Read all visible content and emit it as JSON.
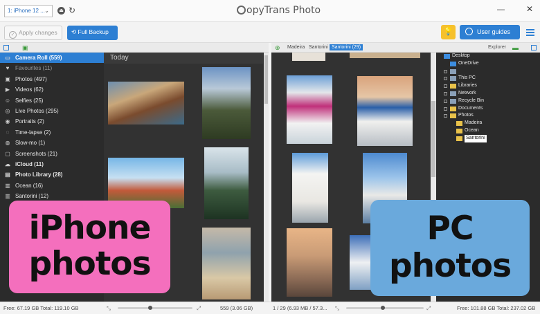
{
  "titlebar": {
    "device_name": "1: iPhone 12 ...",
    "app_title": "opyTrans Photo"
  },
  "toolbar": {
    "apply_label": "Apply changes",
    "backup_label": "Full Backup",
    "guides_label": "User guides"
  },
  "left_panel": {
    "items": [
      {
        "label": "Camera Roll (559)",
        "icon": "camera-icon",
        "state": "selected"
      },
      {
        "label": "Favourites (11)",
        "icon": "heart-icon",
        "state": "dim"
      },
      {
        "label": "Photos (497)",
        "icon": "image-icon",
        "state": "normal"
      },
      {
        "label": "Videos (62)",
        "icon": "video-icon",
        "state": "normal"
      },
      {
        "label": "Selfies (25)",
        "icon": "selfie-icon",
        "state": "normal"
      },
      {
        "label": "Live Photos (295)",
        "icon": "live-photo-icon",
        "state": "normal"
      },
      {
        "label": "Portraits (2)",
        "icon": "portrait-icon",
        "state": "normal"
      },
      {
        "label": "Time-lapse (2)",
        "icon": "timelapse-icon",
        "state": "normal"
      },
      {
        "label": "Slow-mo (1)",
        "icon": "slowmo-icon",
        "state": "normal"
      },
      {
        "label": "Screenshots (21)",
        "icon": "screenshot-icon",
        "state": "normal"
      },
      {
        "label": "iCloud (11)",
        "icon": "cloud-icon",
        "state": "group"
      },
      {
        "label": "Photo Library (28)",
        "icon": "library-icon",
        "state": "group"
      },
      {
        "label": "Ocean (16)",
        "icon": "album-icon",
        "state": "normal"
      },
      {
        "label": "Santorini (12)",
        "icon": "album-icon",
        "state": "normal"
      }
    ],
    "grid_header": "Today"
  },
  "right_panel": {
    "tabs": [
      {
        "label": "Madeira",
        "active": false
      },
      {
        "label": "Santorini",
        "active": false
      },
      {
        "label": "Santorini (29)",
        "active": true
      }
    ],
    "explorer_label": "Explorer",
    "tree": [
      {
        "label": "Desktop",
        "indent": 0,
        "folder": "blue",
        "box": false
      },
      {
        "label": "OneDrive",
        "indent": 1,
        "folder": "blue",
        "box": false
      },
      {
        "label": "",
        "indent": 1,
        "folder": "gray",
        "box": true
      },
      {
        "label": "This PC",
        "indent": 1,
        "folder": "gray",
        "box": true
      },
      {
        "label": "Libraries",
        "indent": 1,
        "folder": "yellow",
        "box": true
      },
      {
        "label": "Network",
        "indent": 1,
        "folder": "gray",
        "box": true
      },
      {
        "label": "Recycle Bin",
        "indent": 1,
        "folder": "gray",
        "box": true
      },
      {
        "label": "Documents",
        "indent": 1,
        "folder": "yellow",
        "box": true
      },
      {
        "label": "Photos",
        "indent": 1,
        "folder": "yellow",
        "box": true
      },
      {
        "label": "Madeira",
        "indent": 2,
        "folder": "yellow",
        "box": false
      },
      {
        "label": "Ocean",
        "indent": 2,
        "folder": "yellow",
        "box": false
      },
      {
        "label": "Santorini",
        "indent": 2,
        "folder": "yellow",
        "box": false,
        "selected": true
      }
    ]
  },
  "status": {
    "left_free": "Free: 67.19 GB Total: 119.10 GB",
    "left_count": "559 (3.06 GB)",
    "right_count": "1 / 29 (6.93 MB / 57.3...",
    "right_free": "Free: 101.88 GB Total: 237.02 GB"
  },
  "overlays": {
    "iphone_line1": "iPhone",
    "iphone_line2": "photos",
    "pc_line1": "PC",
    "pc_line2": "photos"
  },
  "colors": {
    "accent": "#2d7fd3",
    "sidebar_bg": "#2b2b2b",
    "grid_bg": "#323232",
    "pink_overlay": "#f46fbd",
    "blue_overlay": "#6aa9dc",
    "bulb_yellow": "#f6c12c"
  }
}
